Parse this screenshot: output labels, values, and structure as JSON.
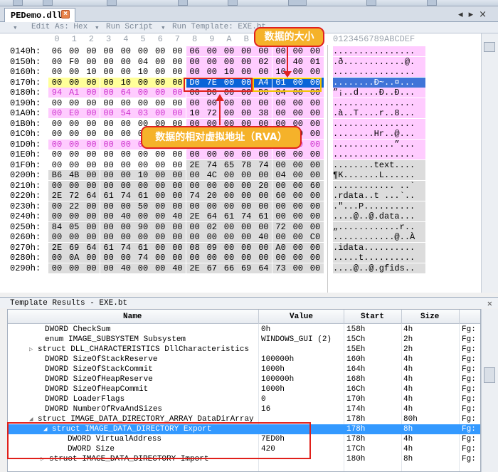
{
  "tab": {
    "filename": "PEDemo.dll"
  },
  "editor_toolbar": {
    "edit_as": "Edit As: Hex",
    "run_script": "Run Script",
    "run_template": "Run Template: EXE.bt"
  },
  "hex": {
    "column_headers": [
      "0",
      "1",
      "2",
      "3",
      "4",
      "5",
      "6",
      "7",
      "8",
      "9",
      "A",
      "B",
      "C",
      "D",
      "E",
      "F"
    ],
    "ascii_header": "0123456789ABCDEF",
    "rows": [
      {
        "addr": "0140h:",
        "bytes": [
          "06",
          "00",
          "00",
          "00",
          "00",
          "00",
          "00",
          "00",
          "06",
          "00",
          "00",
          "00",
          "00",
          "00",
          "00",
          "00"
        ],
        "ascii": "................"
      },
      {
        "addr": "0150h:",
        "bytes": [
          "00",
          "F0",
          "00",
          "00",
          "00",
          "04",
          "00",
          "00",
          "00",
          "00",
          "00",
          "00",
          "02",
          "00",
          "40",
          "01"
        ],
        "ascii": ".ð............@."
      },
      {
        "addr": "0160h:",
        "bytes": [
          "00",
          "00",
          "10",
          "00",
          "00",
          "10",
          "00",
          "00",
          "00",
          "00",
          "10",
          "00",
          "00",
          "10",
          "00",
          "00"
        ],
        "ascii": "................"
      },
      {
        "addr": "0170h:",
        "bytes": [
          "00",
          "00",
          "00",
          "00",
          "10",
          "00",
          "00",
          "00",
          "D0",
          "7E",
          "00",
          "00",
          "A4",
          "01",
          "00",
          "00"
        ],
        "ascii": "........Ð~..¤..."
      },
      {
        "addr": "0180h:",
        "bytes": [
          "94",
          "A1",
          "00",
          "00",
          "64",
          "00",
          "00",
          "00",
          "00",
          "D0",
          "00",
          "00",
          "D0",
          "04",
          "00",
          "00"
        ],
        "ascii": "”¡..d....Ð..Ð..."
      },
      {
        "addr": "0190h:",
        "bytes": [
          "00",
          "00",
          "00",
          "00",
          "00",
          "00",
          "00",
          "00",
          "00",
          "00",
          "00",
          "00",
          "00",
          "00",
          "00",
          "00"
        ],
        "ascii": "................"
      },
      {
        "addr": "01A0h:",
        "bytes": [
          "00",
          "E0",
          "00",
          "00",
          "54",
          "03",
          "00",
          "00",
          "10",
          "72",
          "00",
          "00",
          "38",
          "00",
          "00",
          "00"
        ],
        "ascii": ".à..T....r..8..."
      },
      {
        "addr": "01B0h:",
        "bytes": [
          "00",
          "00",
          "00",
          "00",
          "00",
          "00",
          "00",
          "00",
          "00",
          "00",
          "00",
          "00",
          "00",
          "00",
          "00",
          "00"
        ],
        "ascii": "................"
      },
      {
        "addr": "01C0h:",
        "bytes": [
          "00",
          "00",
          "00",
          "00",
          "00",
          "00",
          "00",
          "00",
          "48",
          "72",
          "00",
          "00",
          "40",
          "00",
          "00",
          "00"
        ],
        "ascii": "........Hr..@..."
      },
      {
        "addr": "01D0h:",
        "bytes": [
          "00",
          "00",
          "00",
          "00",
          "00",
          "00",
          "00",
          "00",
          "00",
          "00",
          "00",
          "00",
          "94",
          "01",
          "00",
          "00"
        ],
        "ascii": "............”..."
      },
      {
        "addr": "01E0h:",
        "bytes": [
          "00",
          "00",
          "00",
          "00",
          "00",
          "00",
          "00",
          "00",
          "00",
          "00",
          "00",
          "00",
          "00",
          "00",
          "00",
          "00"
        ],
        "ascii": "................"
      },
      {
        "addr": "01F0h:",
        "bytes": [
          "00",
          "00",
          "00",
          "00",
          "00",
          "00",
          "00",
          "00",
          "2E",
          "74",
          "65",
          "78",
          "74",
          "00",
          "00",
          "00"
        ],
        "ascii": "........text...."
      },
      {
        "addr": "0200h:",
        "bytes": [
          "B6",
          "4B",
          "00",
          "00",
          "00",
          "10",
          "00",
          "00",
          "00",
          "4C",
          "00",
          "00",
          "00",
          "04",
          "00",
          "00"
        ],
        "ascii": "¶K.......L......"
      },
      {
        "addr": "0210h:",
        "bytes": [
          "00",
          "00",
          "00",
          "00",
          "00",
          "00",
          "00",
          "00",
          "00",
          "00",
          "00",
          "00",
          "20",
          "00",
          "00",
          "60"
        ],
        "ascii": "............ ..`"
      },
      {
        "addr": "0220h:",
        "bytes": [
          "2E",
          "72",
          "64",
          "61",
          "74",
          "61",
          "00",
          "00",
          "74",
          "20",
          "00",
          "00",
          "00",
          "60",
          "00",
          "00"
        ],
        "ascii": ".rdata..t ...`.."
      },
      {
        "addr": "0230h:",
        "bytes": [
          "00",
          "22",
          "00",
          "00",
          "00",
          "50",
          "00",
          "00",
          "00",
          "00",
          "00",
          "00",
          "00",
          "00",
          "00",
          "00"
        ],
        "ascii": ".\"...P.........."
      },
      {
        "addr": "0240h:",
        "bytes": [
          "00",
          "00",
          "00",
          "00",
          "40",
          "00",
          "00",
          "40",
          "2E",
          "64",
          "61",
          "74",
          "61",
          "00",
          "00",
          "00"
        ],
        "ascii": "....@..@.data..."
      },
      {
        "addr": "0250h:",
        "bytes": [
          "84",
          "05",
          "00",
          "00",
          "00",
          "90",
          "00",
          "00",
          "00",
          "02",
          "00",
          "00",
          "00",
          "72",
          "00",
          "00"
        ],
        "ascii": "„............r.."
      },
      {
        "addr": "0260h:",
        "bytes": [
          "00",
          "00",
          "00",
          "00",
          "00",
          "00",
          "00",
          "00",
          "00",
          "00",
          "00",
          "00",
          "40",
          "00",
          "00",
          "C0"
        ],
        "ascii": "............@..À"
      },
      {
        "addr": "0270h:",
        "bytes": [
          "2E",
          "69",
          "64",
          "61",
          "74",
          "61",
          "00",
          "00",
          "08",
          "09",
          "00",
          "00",
          "00",
          "A0",
          "00",
          "00"
        ],
        "ascii": ".idata.........."
      },
      {
        "addr": "0280h:",
        "bytes": [
          "00",
          "0A",
          "00",
          "00",
          "00",
          "74",
          "00",
          "00",
          "00",
          "00",
          "00",
          "00",
          "00",
          "00",
          "00",
          "00"
        ],
        "ascii": ".....t.........."
      },
      {
        "addr": "0290h:",
        "bytes": [
          "00",
          "00",
          "00",
          "00",
          "40",
          "00",
          "00",
          "40",
          "2E",
          "67",
          "66",
          "69",
          "64",
          "73",
          "00",
          "00"
        ],
        "ascii": "....@..@.gfids.."
      }
    ]
  },
  "annotations": {
    "size_label": "数据的大小",
    "rva_label": "数据的相对虚拟地址（RVA）"
  },
  "results": {
    "title": "Template Results - EXE.bt",
    "close": "✕",
    "headers": {
      "name": "Name",
      "value": "Value",
      "start": "Start",
      "size": "Size"
    },
    "rows": [
      {
        "name": "DWORD CheckSum",
        "value": "0h",
        "start": "158h",
        "size": "4h",
        "extra": "Fg:"
      },
      {
        "name": "enum IMAGE_SUBSYSTEM Subsystem",
        "value": "WINDOWS_GUI (2)",
        "start": "15Ch",
        "size": "2h",
        "extra": "Fg:"
      },
      {
        "name": "struct DLL_CHARACTERISTICS DllCharacteristics",
        "value": "",
        "start": "15Eh",
        "size": "2h",
        "extra": "Fg:"
      },
      {
        "name": "DWORD SizeOfStackReserve",
        "value": "100000h",
        "start": "160h",
        "size": "4h",
        "extra": "Fg:"
      },
      {
        "name": "DWORD SizeOfStackCommit",
        "value": "1000h",
        "start": "164h",
        "size": "4h",
        "extra": "Fg:"
      },
      {
        "name": "DWORD SizeOfHeapReserve",
        "value": "100000h",
        "start": "168h",
        "size": "4h",
        "extra": "Fg:"
      },
      {
        "name": "DWORD SizeOfHeapCommit",
        "value": "1000h",
        "start": "16Ch",
        "size": "4h",
        "extra": "Fg:"
      },
      {
        "name": "DWORD LoaderFlags",
        "value": "0",
        "start": "170h",
        "size": "4h",
        "extra": "Fg:"
      },
      {
        "name": "DWORD NumberOfRvaAndSizes",
        "value": "16",
        "start": "174h",
        "size": "4h",
        "extra": "Fg:"
      },
      {
        "name": "struct IMAGE_DATA_DIRECTORY_ARRAY DataDirArray",
        "value": "",
        "start": "178h",
        "size": "80h",
        "extra": "Fg:"
      },
      {
        "name": "struct IMAGE_DATA_DIRECTORY Export",
        "value": "",
        "start": "178h",
        "size": "8h",
        "extra": "Fg:"
      },
      {
        "name": "DWORD VirtualAddress",
        "value": "7ED0h",
        "start": "178h",
        "size": "4h",
        "extra": "Fg:"
      },
      {
        "name": "DWORD Size",
        "value": "420",
        "start": "17Ch",
        "size": "4h",
        "extra": "Fg:"
      },
      {
        "name": "struct IMAGE_DATA_DIRECTORY Import",
        "value": "",
        "start": "180h",
        "size": "8h",
        "extra": "Fg:"
      }
    ]
  }
}
